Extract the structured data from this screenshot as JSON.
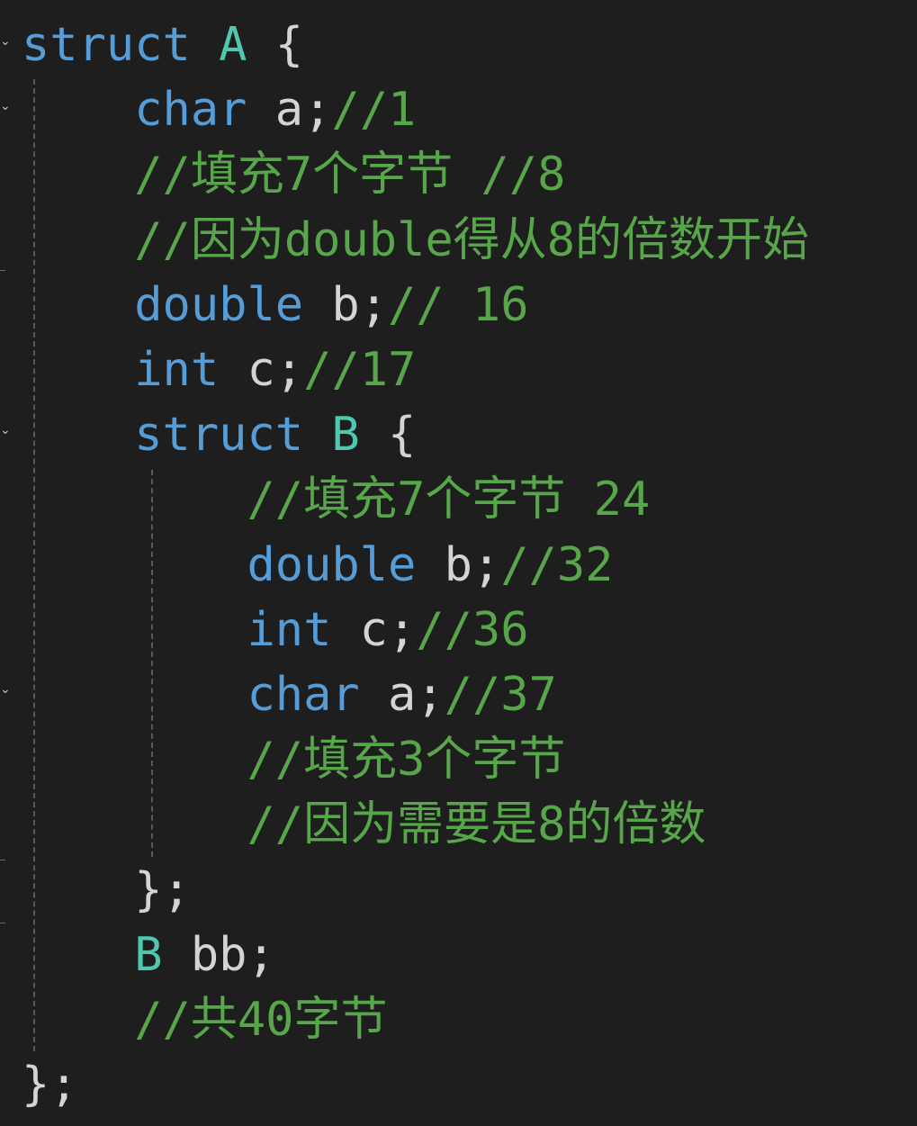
{
  "editor": {
    "lines": [
      [
        {
          "t": "struct",
          "c": "kw"
        },
        {
          "t": " ",
          "c": "id"
        },
        {
          "t": "A",
          "c": "type"
        },
        {
          "t": " ",
          "c": "id"
        },
        {
          "t": "{",
          "c": "punct"
        }
      ],
      [
        {
          "t": "    ",
          "c": "id"
        },
        {
          "t": "char",
          "c": "kw"
        },
        {
          "t": " a;",
          "c": "id"
        },
        {
          "t": "//1",
          "c": "cm"
        }
      ],
      [
        {
          "t": "    ",
          "c": "id"
        },
        {
          "t": "//填充7个字节 //8",
          "c": "cm"
        }
      ],
      [
        {
          "t": "    ",
          "c": "id"
        },
        {
          "t": "//因为double得从8的倍数开始",
          "c": "cm"
        }
      ],
      [
        {
          "t": "    ",
          "c": "id"
        },
        {
          "t": "double",
          "c": "kw"
        },
        {
          "t": " b;",
          "c": "id"
        },
        {
          "t": "// 16",
          "c": "cm"
        }
      ],
      [
        {
          "t": "    ",
          "c": "id"
        },
        {
          "t": "int",
          "c": "kw"
        },
        {
          "t": " c;",
          "c": "id"
        },
        {
          "t": "//17",
          "c": "cm"
        }
      ],
      [
        {
          "t": "    ",
          "c": "id"
        },
        {
          "t": "struct",
          "c": "kw"
        },
        {
          "t": " ",
          "c": "id"
        },
        {
          "t": "B",
          "c": "type"
        },
        {
          "t": " ",
          "c": "id"
        },
        {
          "t": "{",
          "c": "punct"
        }
      ],
      [
        {
          "t": "        ",
          "c": "id"
        },
        {
          "t": "//填充7个字节 24",
          "c": "cm"
        }
      ],
      [
        {
          "t": "        ",
          "c": "id"
        },
        {
          "t": "double",
          "c": "kw"
        },
        {
          "t": " b;",
          "c": "id"
        },
        {
          "t": "//32",
          "c": "cm"
        }
      ],
      [
        {
          "t": "        ",
          "c": "id"
        },
        {
          "t": "int",
          "c": "kw"
        },
        {
          "t": " c;",
          "c": "id"
        },
        {
          "t": "//36",
          "c": "cm"
        }
      ],
      [
        {
          "t": "        ",
          "c": "id"
        },
        {
          "t": "char",
          "c": "kw"
        },
        {
          "t": " a;",
          "c": "id"
        },
        {
          "t": "//37",
          "c": "cm"
        }
      ],
      [
        {
          "t": "        ",
          "c": "id"
        },
        {
          "t": "//填充3个字节",
          "c": "cm"
        }
      ],
      [
        {
          "t": "        ",
          "c": "id"
        },
        {
          "t": "//因为需要是8的倍数",
          "c": "cm"
        }
      ],
      [
        {
          "t": "    ",
          "c": "id"
        },
        {
          "t": "};",
          "c": "punct"
        }
      ],
      [
        {
          "t": "    ",
          "c": "id"
        },
        {
          "t": "B",
          "c": "type"
        },
        {
          "t": " bb;",
          "c": "id"
        }
      ],
      [
        {
          "t": "    ",
          "c": "id"
        },
        {
          "t": "//共40字节",
          "c": "cm"
        }
      ],
      [
        {
          "t": "};",
          "c": "punct"
        }
      ]
    ]
  },
  "colors": {
    "background": "#1e1e1e",
    "keyword": "#569cd6",
    "type": "#4ec9b0",
    "identifier": "#d4d4d4",
    "comment": "#57a64a"
  }
}
